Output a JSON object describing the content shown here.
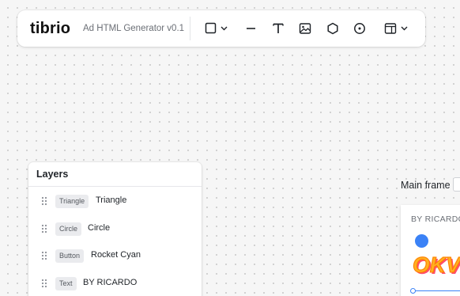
{
  "toolbar": {
    "logo": "tibrio",
    "app_title": "Ad HTML Generator v0.1",
    "tools": [
      {
        "name": "rectangle-tool",
        "icon": "square-icon",
        "has_dropdown": true
      },
      {
        "name": "line-tool",
        "icon": "line-icon"
      },
      {
        "name": "text-tool",
        "icon": "text-icon"
      },
      {
        "name": "image-tool",
        "icon": "image-icon"
      },
      {
        "name": "shape-tool",
        "icon": "hexagon-icon"
      },
      {
        "name": "circle-tool",
        "icon": "circle-dot-icon"
      },
      {
        "name": "layout-tool",
        "icon": "layout-icon",
        "has_dropdown": true
      }
    ]
  },
  "layers": {
    "title": "Layers",
    "items": [
      {
        "type": "Triangle",
        "name": "Triangle"
      },
      {
        "type": "Circle",
        "name": "Circle"
      },
      {
        "type": "Button",
        "name": "Rocket Cyan"
      },
      {
        "type": "Text",
        "name": "BY RICARDO"
      }
    ]
  },
  "canvas": {
    "frame_label": "Main frame",
    "frame_text": "BY RICARDO",
    "frame_logo_text": "OKV",
    "circle_color": "#3b82f6",
    "accent": "#3b82f6"
  }
}
